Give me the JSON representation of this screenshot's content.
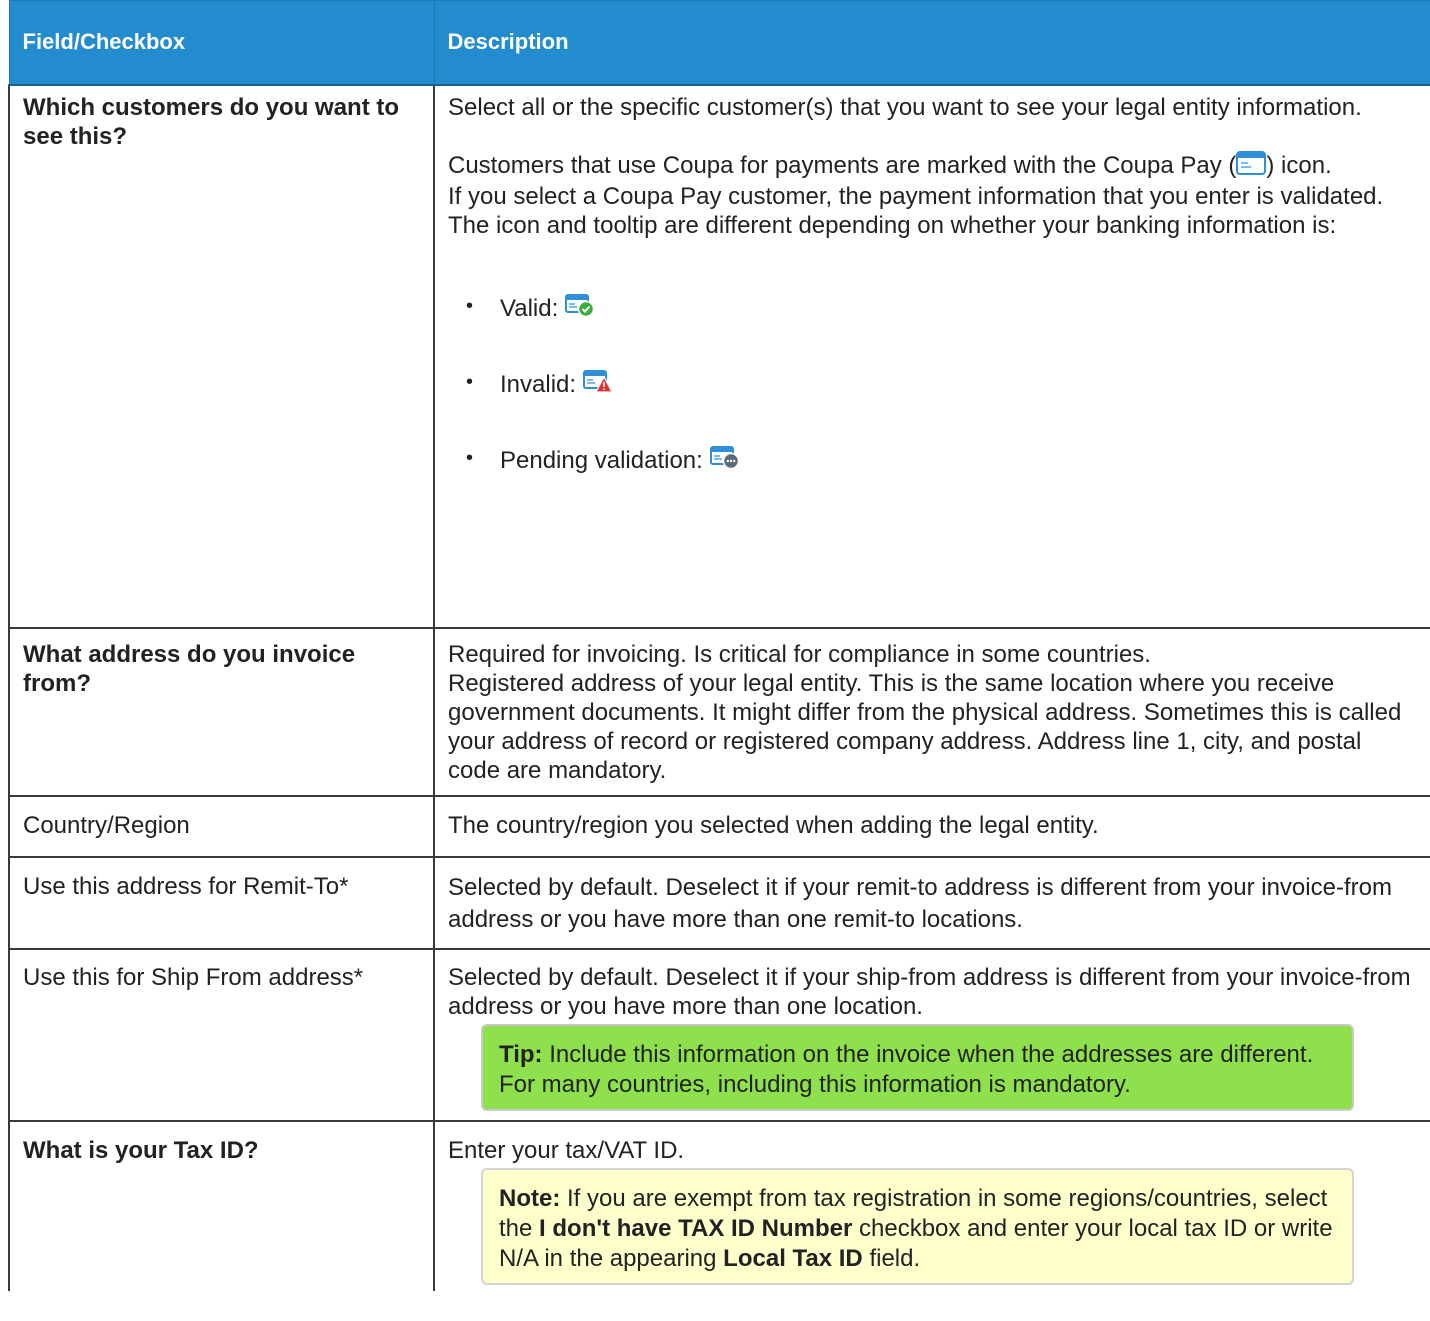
{
  "header": {
    "col1": "Field/Checkbox",
    "col2": "Description"
  },
  "rows": [
    {
      "field": "Which customers do you want to see this?",
      "intro": "Select all or the specific customer(s) that you want to see your legal entity information.",
      "coupa_pay_before": "Customers that use Coupa for payments are marked with the Coupa Pay (",
      "coupa_pay_after": ") icon.",
      "validation_text": "If you select a Coupa Pay customer, the payment information that you enter is validated. The icon and tooltip are different depending on whether your banking information is:",
      "statuses": [
        {
          "label": "Valid:",
          "icon": "valid-payment-icon"
        },
        {
          "label": "Invalid:",
          "icon": "invalid-payment-icon"
        },
        {
          "label": "Pending validation:",
          "icon": "pending-payment-icon"
        }
      ]
    },
    {
      "field": "What address do you invoice from?",
      "lines": [
        "Required for invoicing. Is critical for compliance in some countries.",
        "Registered address of your legal entity. This is the same location where you receive government documents. It might differ from the physical address. Sometimes this is called your address of record or registered company address. Address line 1, city, and postal code are mandatory."
      ]
    },
    {
      "field": "Country/Region",
      "description": "The country/region you selected when adding the legal entity."
    },
    {
      "field": "Use this address for Remit-To*",
      "description": "Selected by default. Deselect it if your remit-to address is different from your invoice-from address or you have more than one remit-to locations."
    },
    {
      "field": "Use this for Ship From address*",
      "description": "Selected by default. Deselect it if your ship-from address is different from your invoice-from address or you have more than one location.",
      "tip_label": "Tip:",
      "tip_text": "Include this information on the invoice when the addresses are different. For many countries, including this information is mandatory."
    },
    {
      "field": "What is your Tax ID?",
      "description": "Enter your tax/VAT ID.",
      "note_label": "Note:",
      "note_part1": "If you are exempt from tax registration in some regions/countries, select the",
      "note_bold1": "I don't have TAX ID Number",
      "note_part2": "checkbox and enter your local tax ID or write N/A in the appearing",
      "note_bold2": "Local Tax ID",
      "note_part3": "field."
    }
  ],
  "colors": {
    "header_bg": "#238ccf",
    "tip_bg": "#8ee04c",
    "note_bg": "#ffffcc",
    "valid_badge": "#3cae3c",
    "invalid_badge": "#e53030",
    "pending_badge": "#5d6a78"
  }
}
